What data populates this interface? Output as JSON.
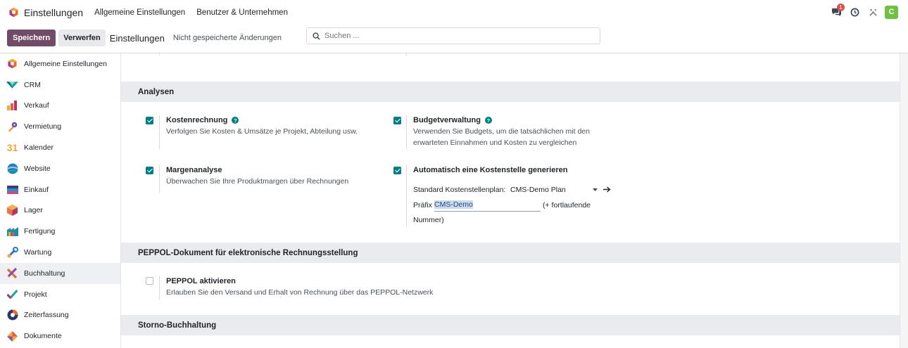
{
  "topbar": {
    "app_name": "Einstellungen",
    "menu": [
      "Allgemeine Einstellungen",
      "Benutzer & Unternehmen"
    ],
    "messages_badge": "1",
    "avatar_letter": "C"
  },
  "control": {
    "save_label": "Speichern",
    "discard_label": "Verwerfen",
    "title": "Einstellungen",
    "unsaved": "Nicht gespeicherte Änderungen",
    "search_placeholder": "Suchen ..."
  },
  "sidebar": {
    "items": [
      {
        "label": "Allgemeine Einstellungen",
        "icon": "settings-icon"
      },
      {
        "label": "CRM",
        "icon": "crm-icon"
      },
      {
        "label": "Verkauf",
        "icon": "sales-icon"
      },
      {
        "label": "Vermietung",
        "icon": "rental-icon"
      },
      {
        "label": "Kalender",
        "icon": "calendar-icon"
      },
      {
        "label": "Website",
        "icon": "website-icon"
      },
      {
        "label": "Einkauf",
        "icon": "purchase-icon"
      },
      {
        "label": "Lager",
        "icon": "inventory-icon"
      },
      {
        "label": "Fertigung",
        "icon": "manufacturing-icon"
      },
      {
        "label": "Wartung",
        "icon": "maintenance-icon"
      },
      {
        "label": "Buchhaltung",
        "icon": "accounting-icon",
        "active": true
      },
      {
        "label": "Projekt",
        "icon": "project-icon"
      },
      {
        "label": "Zeiterfassung",
        "icon": "timesheet-icon"
      },
      {
        "label": "Dokumente",
        "icon": "documents-icon"
      }
    ],
    "calendar_day": "31"
  },
  "sections": {
    "analysen": {
      "title": "Analysen",
      "kostenrechnung": {
        "title": "Kostenrechnung",
        "desc": "Verfolgen Sie Kosten & Umsätze je Projekt, Abteilung usw.",
        "checked": true
      },
      "budget": {
        "title": "Budgetverwaltung",
        "desc_1": "Verwenden Sie Budgets, um die tatsächlichen mit den",
        "desc_2": "erwarteten Einnahmen und Kosten zu vergleichen",
        "checked": true
      },
      "marge": {
        "title": "Margenanalyse",
        "desc": "Überwachen Sie Ihre Produktmargen über Rechnungen",
        "checked": true
      },
      "auto_kst": {
        "title": "Automatisch eine Kostenstelle generieren",
        "checked": true,
        "plan_label": "Standard Kostenstellenplan:",
        "plan_value": "CMS-Demo Plan",
        "prefix_label": "Präfix",
        "prefix_value": "CMS-Demo",
        "suffix_1": "(+ fortlaufende",
        "suffix_2": "Nummer)"
      }
    },
    "peppol": {
      "title": "PEPPOL-Dokument für elektronische Rechnungsstellung",
      "activate": {
        "title": "PEPPOL aktivieren",
        "desc": "Erlauben Sie den Versand und Erhalt von Rechnung über das PEPPOL-Netzwerk",
        "checked": false
      }
    },
    "storno": {
      "title": "Storno-Buchhaltung"
    }
  },
  "help_glyph": "?",
  "colors": {
    "primary": "#714b67",
    "checkbox": "#017e84",
    "section_bg": "#e9ebee"
  }
}
